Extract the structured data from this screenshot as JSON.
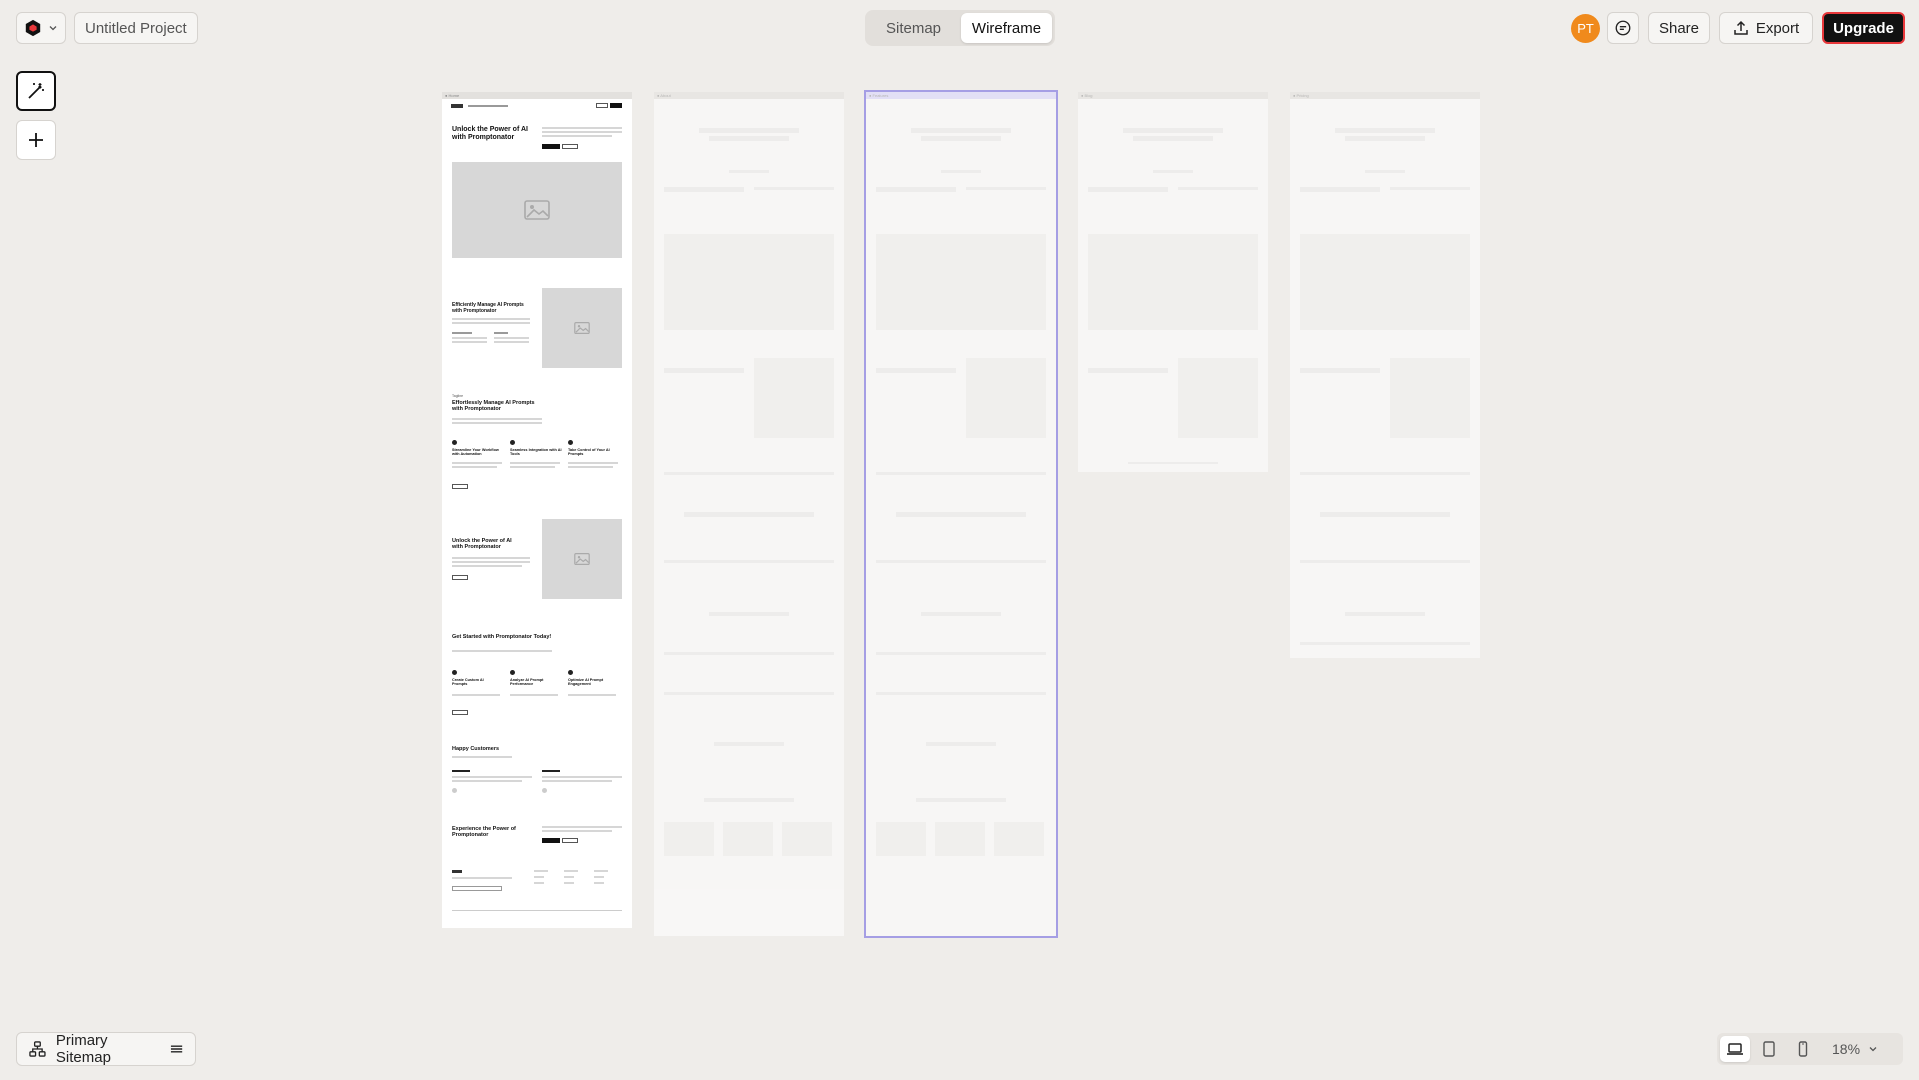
{
  "app": {
    "project_title": "Untitled Project",
    "accent_color": "#6a5fe0",
    "upgrade_border_color": "#e8383b"
  },
  "toolbar": {
    "view_tabs": [
      {
        "label": "Sitemap",
        "active": false
      },
      {
        "label": "Wireframe",
        "active": true
      }
    ],
    "avatar_initials": "PT",
    "share_label": "Share",
    "export_label": "Export",
    "upgrade_label": "Upgrade"
  },
  "tools": {
    "magic": "magic-wand-icon",
    "add": "plus-icon"
  },
  "wireframe": {
    "hero_title": "Unlock the Power of AI with Promptonator",
    "section2_title": "Efficiently Manage AI Prompts with Promptonator",
    "section3_label": "Tagline",
    "section3_title": "Effortlessly Manage AI Prompts with Promptonator",
    "features": [
      {
        "title": "Streamline Your Workflow with Automation"
      },
      {
        "title": "Seamless Integration with AI Tools"
      },
      {
        "title": "Take Control of Your AI Prompts"
      }
    ],
    "section4_title": "Unlock the Power of AI with Promptonator",
    "section5_title": "Get Started with Promptonator Today!",
    "steps": [
      {
        "title": "Create Custom AI Prompts"
      },
      {
        "title": "Analyze AI Prompt Performance"
      },
      {
        "title": "Optimize AI Prompt Engagement"
      }
    ],
    "testimonials_title": "Happy Customers",
    "cta_title": "Experience the Power of Promptonator"
  },
  "footer": {
    "sitemap_label": "Primary Sitemap",
    "zoom_label": "18%"
  }
}
